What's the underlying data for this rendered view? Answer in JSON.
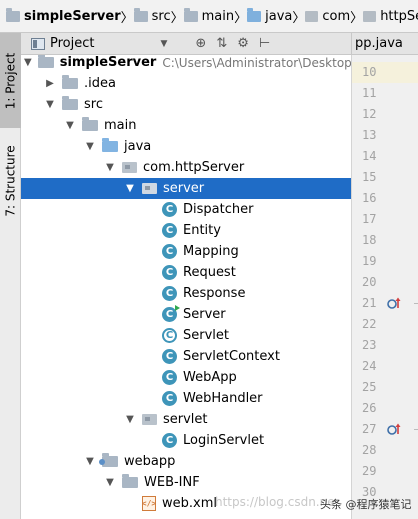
{
  "breadcrumbs": [
    {
      "label": "simpleServer",
      "icon": "folder-icon",
      "bold": true
    },
    {
      "label": "src",
      "icon": "folder-icon"
    },
    {
      "label": "main",
      "icon": "folder-icon"
    },
    {
      "label": "java",
      "icon": "source-folder-icon"
    },
    {
      "label": "com",
      "icon": "package-icon"
    },
    {
      "label": "httpServer",
      "icon": "package-icon"
    }
  ],
  "side_tabs": {
    "project": "1: Project",
    "structure": "7: Structure"
  },
  "panel": {
    "title": "Project",
    "caret": "▼",
    "tools": [
      "⊕",
      "⇅",
      "⚙",
      "⊢"
    ]
  },
  "editor_tab": {
    "label": "pp.java"
  },
  "tree": [
    {
      "label": "simpleServer",
      "path": "C:\\Users\\Administrator\\Desktop\\eb",
      "icon": "folder",
      "depth": 0,
      "arrow": "down",
      "bold": true
    },
    {
      "label": ".idea",
      "icon": "folder",
      "depth": 1,
      "arrow": "right"
    },
    {
      "label": "src",
      "icon": "folder",
      "depth": 1,
      "arrow": "down"
    },
    {
      "label": "main",
      "icon": "folder",
      "depth": 2,
      "arrow": "down"
    },
    {
      "label": "java",
      "icon": "source-folder",
      "depth": 3,
      "arrow": "down"
    },
    {
      "label": "com.httpServer",
      "icon": "package",
      "depth": 4,
      "arrow": "down"
    },
    {
      "label": "server",
      "icon": "package",
      "depth": 5,
      "arrow": "down",
      "selected": true
    },
    {
      "label": "Dispatcher",
      "icon": "class",
      "depth": 6
    },
    {
      "label": "Entity",
      "icon": "class",
      "depth": 6
    },
    {
      "label": "Mapping",
      "icon": "class",
      "depth": 6
    },
    {
      "label": "Request",
      "icon": "class",
      "depth": 6
    },
    {
      "label": "Response",
      "icon": "class",
      "depth": 6
    },
    {
      "label": "Server",
      "icon": "class-run",
      "depth": 6
    },
    {
      "label": "Servlet",
      "icon": "class-abstract",
      "depth": 6
    },
    {
      "label": "ServletContext",
      "icon": "class",
      "depth": 6
    },
    {
      "label": "WebApp",
      "icon": "class",
      "depth": 6
    },
    {
      "label": "WebHandler",
      "icon": "class",
      "depth": 6
    },
    {
      "label": "servlet",
      "icon": "package",
      "depth": 5,
      "arrow": "down"
    },
    {
      "label": "LoginServlet",
      "icon": "class",
      "depth": 6
    },
    {
      "label": "webapp",
      "icon": "web-folder",
      "depth": 3,
      "arrow": "down"
    },
    {
      "label": "WEB-INF",
      "icon": "folder",
      "depth": 4,
      "arrow": "down"
    },
    {
      "label": "web.xml",
      "icon": "xml",
      "depth": 5
    }
  ],
  "class_letter": "C",
  "xml_letter": "</>",
  "gutter": {
    "lines": [
      "10",
      "11",
      "12",
      "13",
      "14",
      "15",
      "16",
      "17",
      "18",
      "19",
      "20",
      "21",
      "22",
      "23",
      "24",
      "25",
      "26",
      "27",
      "28",
      "29",
      "30"
    ],
    "override_marks_at": [
      "21",
      "27"
    ]
  },
  "watermark": "https://blog.csdn.ne",
  "brand": "头条 @程序猿笔记",
  "colors": {
    "selection": "#1f6cc6",
    "class_icon": "#3e95b9",
    "override_mark": "#d23f3f",
    "run_mark": "#2fa84f"
  }
}
